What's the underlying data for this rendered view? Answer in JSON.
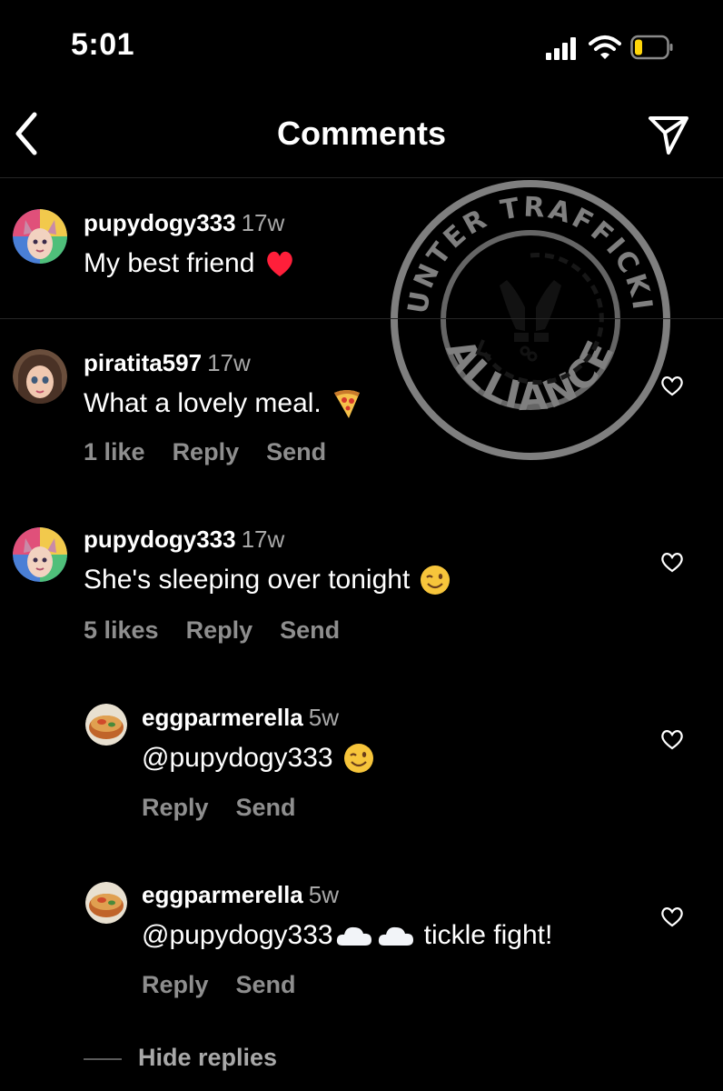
{
  "status_bar": {
    "time": "5:01"
  },
  "header": {
    "title": "Comments"
  },
  "watermark": {
    "top_text": "COUNTER TRAFFICKING",
    "bottom_text": "ALLIANCE"
  },
  "comments": [
    {
      "username": "pupydogy333",
      "age": "17w",
      "text": "My best friend",
      "emoji": "red-heart"
    },
    {
      "username": "piratita597",
      "age": "17w",
      "text": "What a lovely meal.",
      "emoji": "pizza",
      "likes": "1 like",
      "reply": "Reply",
      "send": "Send"
    },
    {
      "username": "pupydogy333",
      "age": "17w",
      "text": "She's sleeping over tonight",
      "emoji": "winking-face",
      "likes": "5 likes",
      "reply": "Reply",
      "send": "Send"
    }
  ],
  "replies": [
    {
      "username": "eggparmerella",
      "age": "5w",
      "text": "@pupydogy333",
      "emoji": "winking-face",
      "reply": "Reply",
      "send": "Send"
    },
    {
      "username": "eggparmerella",
      "age": "5w",
      "text": "@pupydogy333",
      "text_after": "tickle fight!",
      "emoji": "cloud",
      "reply": "Reply",
      "send": "Send"
    }
  ],
  "hide_replies": "Hide replies",
  "colors": {
    "background": "#000000",
    "muted": "#8e8e8e",
    "battery": "#ffd60a",
    "heart": "#ff1f3a"
  }
}
